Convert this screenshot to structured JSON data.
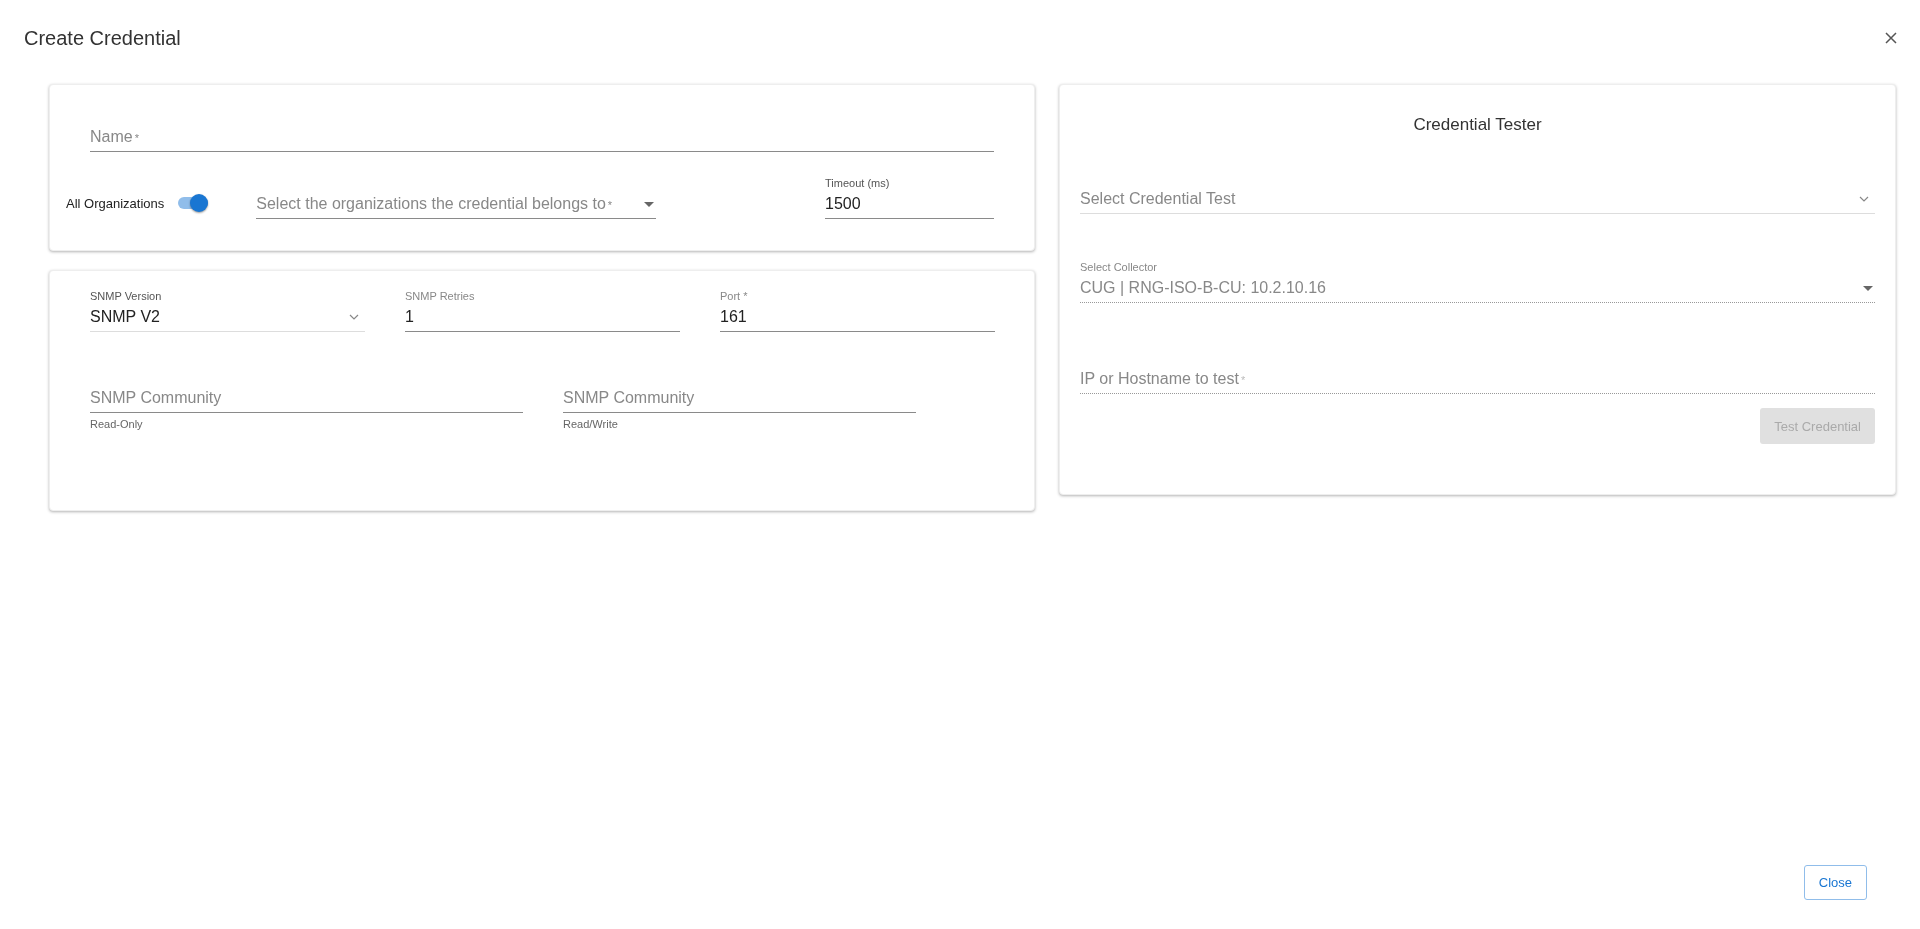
{
  "dialog": {
    "title": "Create Credential"
  },
  "general": {
    "name_field": {
      "placeholder": "Name",
      "required_mark": "*"
    },
    "all_organizations": {
      "label": "All Organizations",
      "on": true
    },
    "organizations_select": {
      "placeholder": "Select the organizations the credential belongs to",
      "required_mark": "*"
    },
    "timeout_field": {
      "label": "Timeout (ms)",
      "value": "1500"
    }
  },
  "snmp": {
    "fields": [
      {
        "kind": "select",
        "label": "SNMP Version",
        "value": "SNMP V2"
      },
      {
        "kind": "input",
        "label": "SNMP Retries",
        "value": "1"
      },
      {
        "kind": "input",
        "label": "Port",
        "required_mark": "*",
        "value": "161"
      }
    ],
    "communities": [
      {
        "placeholder": "SNMP Community",
        "helper": "Read-Only"
      },
      {
        "placeholder": "SNMP Community",
        "helper": "Read/Write"
      }
    ]
  },
  "tester": {
    "title": "Credential Tester",
    "test_select": {
      "placeholder": "Select Credential Test"
    },
    "collector_select": {
      "label": "Select Collector",
      "value": "CUG | RNG-ISO-B-CU: 10.2.10.16",
      "disabled": true
    },
    "host_field": {
      "placeholder": "IP or Hostname to test",
      "required_mark": "*",
      "disabled": true
    },
    "test_button": {
      "label": "Test Credential",
      "disabled": true
    }
  },
  "footer": {
    "close_button": "Close"
  }
}
